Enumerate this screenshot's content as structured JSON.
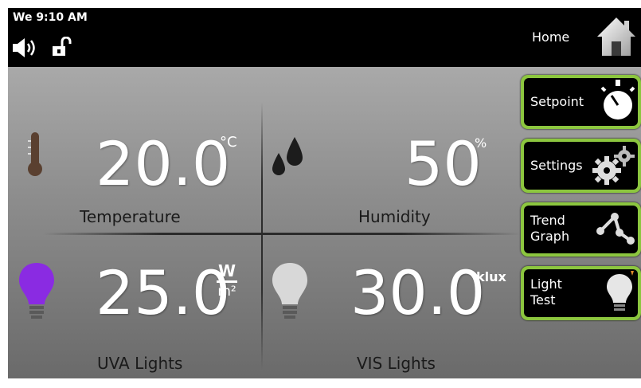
{
  "status_bar": {
    "day_time": "We 9:10 AM",
    "home_label": "Home"
  },
  "readings": {
    "temperature": {
      "value": "20.0",
      "unit": "°C",
      "label": "Temperature"
    },
    "humidity": {
      "value": "50",
      "unit": "%",
      "label": "Humidity"
    },
    "uva": {
      "value": "25.0",
      "unit_num": "W",
      "unit_den": "m²",
      "label": "UVA Lights"
    },
    "vis": {
      "value": "30.0",
      "unit": "klux",
      "label": "VIS Lights"
    }
  },
  "menu": {
    "setpoint": "Setpoint",
    "settings": "Settings",
    "trend_line1": "Trend",
    "trend_line2": "Graph",
    "light_line1": "Light",
    "light_line2": "Test"
  },
  "colors": {
    "button_border": "#8cc63f",
    "uva_bulb": "#8a2be2",
    "vis_bulb": "#d8d8d8"
  },
  "icons": [
    "speaker-icon",
    "unlock-icon",
    "home-icon",
    "thermometer-icon",
    "droplets-icon",
    "uva-bulb-icon",
    "vis-bulb-icon",
    "timer-icon",
    "gears-icon",
    "graph-icon",
    "bulb-icon"
  ]
}
